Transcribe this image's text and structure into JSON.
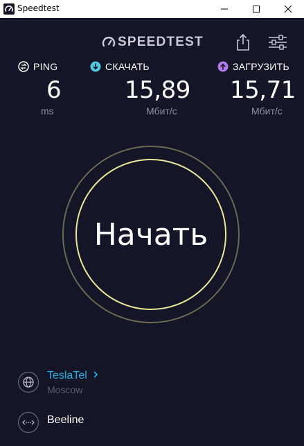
{
  "window": {
    "title": "Speedtest"
  },
  "header": {
    "logo_text": "SPEEDTEST"
  },
  "metrics": [
    {
      "id": "ping",
      "label": "PING",
      "value": "6",
      "unit": "ms",
      "icon": "ping-icon",
      "color": "#ffffff"
    },
    {
      "id": "download",
      "label": "СКАЧАТЬ",
      "value": "15,89",
      "unit": "Мбит/с",
      "icon": "download-icon",
      "color": "#52c7e0"
    },
    {
      "id": "upload",
      "label": "ЗАГРУЗИТЬ",
      "value": "15,71",
      "unit": "Мбит/с",
      "icon": "upload-icon",
      "color": "#b27ce8"
    }
  ],
  "go_button": {
    "label": "Начать",
    "ring_color": "#ece89a"
  },
  "server": {
    "name": "TeslaTel",
    "location": "Moscow"
  },
  "isp": {
    "name": "Beeline"
  },
  "colors": {
    "background": "#141526",
    "accent": "#1fb2e4"
  }
}
